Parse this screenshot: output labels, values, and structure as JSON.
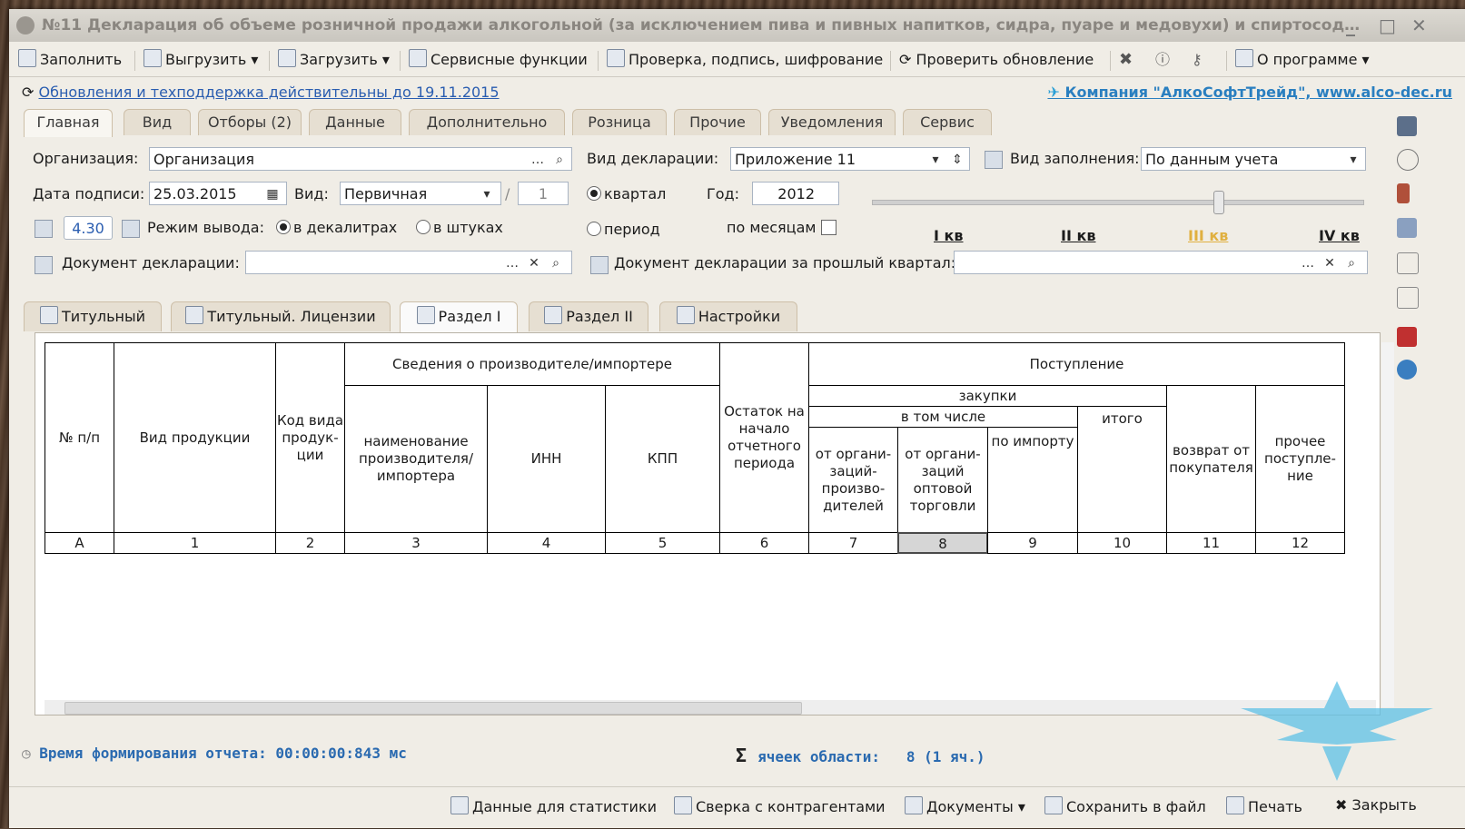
{
  "window": {
    "title": "№11 Декларация об объеме розничной продажи алкогольной (за исключением пива и пивных напитков, сидра, пуаре и медовухи) и спиртосоде…",
    "controls": [
      "_",
      "□",
      "✕"
    ]
  },
  "toolbar": {
    "fill": "Заполнить",
    "export": "Выгрузить",
    "import": "Загрузить",
    "service": "Сервисные функции",
    "check": "Проверка, подпись, шифрование",
    "update": "Проверить обновление",
    "about": "О программе"
  },
  "info": {
    "support_link": "Обновления и техподдержка действительны до 19.11.2015",
    "company": "Компания \"АлкоСофтТрейд\", www.alco-dec.ru"
  },
  "main_tabs": [
    "Главная",
    "Вид",
    "Отборы (2)",
    "Данные",
    "Дополнительно",
    "Розница",
    "Прочие",
    "Уведомления",
    "Сервис"
  ],
  "form": {
    "org_label": "Организация:",
    "org_value": "Организация",
    "decl_type_label": "Вид декларации:",
    "decl_type_value": "Приложение 11",
    "fill_type_label": "Вид заполнения:",
    "fill_type_value": "По данным учета",
    "sign_date_label": "Дата подписи:",
    "sign_date_value": "25.03.2015",
    "kind_label": "Вид:",
    "kind_value": "Первичная",
    "slash": "/",
    "corr_num": "1",
    "quarter_label": "квартал",
    "period_label": "период",
    "year_label": "Год:",
    "year_value": "2012",
    "monthly_label": "по месяцам",
    "version": "4.30",
    "output_mode_label": "Режим вывода:",
    "mode_decaliters": "в декалитрах",
    "mode_pieces": "в штуках",
    "doc_label": "Документ декларации:",
    "prev_doc_label": "Документ декларации за прошлый квартал:",
    "quarters": [
      "I кв",
      "II кв",
      "III кв",
      "IV кв"
    ]
  },
  "sheet_tabs": [
    "Титульный",
    "Титульный. Лицензии",
    "Раздел I",
    "Раздел II",
    "Настройки"
  ],
  "table": {
    "h_num": "№ п/п",
    "h_product": "Вид продукции",
    "h_code": "Код вида продук-ции",
    "h_producer": "Сведения о производителе/импортере",
    "h_name": "наименование производителя/ импортера",
    "h_inn": "ИНН",
    "h_kpp": "КПП",
    "h_rest": "Остаток на начало отчетного периода",
    "h_income": "Поступление",
    "h_purchases": "закупки",
    "h_including": "в том числе",
    "h_total": "итого",
    "h_from_prod": "от органи-заций-произво-дителей",
    "h_from_wholesale": "от органи-заций оптовой торговли",
    "h_import": "по импорту",
    "h_return": "возврат от покупателя",
    "h_other": "прочее поступле-ние",
    "col_numbers": [
      "А",
      "1",
      "2",
      "3",
      "4",
      "5",
      "6",
      "7",
      "8",
      "9",
      "10",
      "11",
      "12"
    ]
  },
  "status": {
    "time_label": "Время формирования отчета:",
    "time_value": "00:00:00:843 мс",
    "cells_label": "ячеек области:",
    "cells_value": "8 (1 яч.)"
  },
  "bottom": {
    "stats": "Данные для статистики",
    "reconcile": "Сверка с контрагентами",
    "documents": "Документы",
    "save_file": "Сохранить в файл",
    "print": "Печать",
    "close": "Закрыть"
  }
}
